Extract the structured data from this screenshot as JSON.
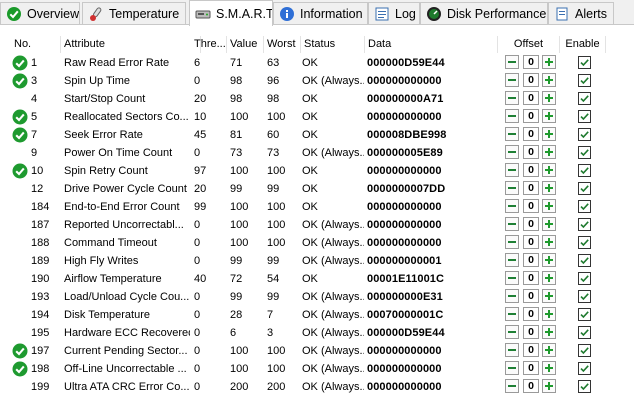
{
  "tabs": [
    {
      "label": "Overview",
      "icon": "overview-icon"
    },
    {
      "label": "Temperature",
      "icon": "thermometer-icon"
    },
    {
      "label": "S.M.A.R.T.",
      "icon": "drive-icon"
    },
    {
      "label": "Information",
      "icon": "info-icon"
    },
    {
      "label": "Log",
      "icon": "log-icon"
    },
    {
      "label": "Disk Performance",
      "icon": "performance-gauge-icon"
    },
    {
      "label": "Alerts",
      "icon": "alerts-icon"
    }
  ],
  "columns": [
    "No.",
    "Attribute",
    "Thre...",
    "Value",
    "Worst",
    "Status",
    "Data",
    "Offset",
    "Enable"
  ],
  "colors": {
    "ok_green": "#1e9a2f",
    "plus_green": "#1f9a2e",
    "minus_green": "#1f7f34"
  },
  "rows": [
    {
      "ok": true,
      "no": "1",
      "attr": "Raw Read Error Rate",
      "thr": "6",
      "val": "71",
      "worst": "63",
      "status": "OK",
      "data": "000000D59E44",
      "offset": "0",
      "enabled": true
    },
    {
      "ok": true,
      "no": "3",
      "attr": "Spin Up Time",
      "thr": "0",
      "val": "98",
      "worst": "96",
      "status": "OK (Always...",
      "data": "000000000000",
      "offset": "0",
      "enabled": true
    },
    {
      "ok": false,
      "no": "4",
      "attr": "Start/Stop Count",
      "thr": "20",
      "val": "98",
      "worst": "98",
      "status": "OK",
      "data": "000000000A71",
      "offset": "0",
      "enabled": true
    },
    {
      "ok": true,
      "no": "5",
      "attr": "Reallocated Sectors Co...",
      "thr": "10",
      "val": "100",
      "worst": "100",
      "status": "OK",
      "data": "000000000000",
      "offset": "0",
      "enabled": true
    },
    {
      "ok": true,
      "no": "7",
      "attr": "Seek Error Rate",
      "thr": "45",
      "val": "81",
      "worst": "60",
      "status": "OK",
      "data": "000008DBE998",
      "offset": "0",
      "enabled": true
    },
    {
      "ok": false,
      "no": "9",
      "attr": "Power On Time Count",
      "thr": "0",
      "val": "73",
      "worst": "73",
      "status": "OK (Always...",
      "data": "000000005E89",
      "offset": "0",
      "enabled": true
    },
    {
      "ok": true,
      "no": "10",
      "attr": "Spin Retry Count",
      "thr": "97",
      "val": "100",
      "worst": "100",
      "status": "OK",
      "data": "000000000000",
      "offset": "0",
      "enabled": true
    },
    {
      "ok": false,
      "no": "12",
      "attr": "Drive Power Cycle Count",
      "thr": "20",
      "val": "99",
      "worst": "99",
      "status": "OK",
      "data": "0000000007DD",
      "offset": "0",
      "enabled": true
    },
    {
      "ok": false,
      "no": "184",
      "attr": "End-to-End Error Count",
      "thr": "99",
      "val": "100",
      "worst": "100",
      "status": "OK",
      "data": "000000000000",
      "offset": "0",
      "enabled": true
    },
    {
      "ok": false,
      "no": "187",
      "attr": "Reported Uncorrectabl...",
      "thr": "0",
      "val": "100",
      "worst": "100",
      "status": "OK (Always...",
      "data": "000000000000",
      "offset": "0",
      "enabled": true
    },
    {
      "ok": false,
      "no": "188",
      "attr": "Command Timeout",
      "thr": "0",
      "val": "100",
      "worst": "100",
      "status": "OK (Always...",
      "data": "000000000000",
      "offset": "0",
      "enabled": true
    },
    {
      "ok": false,
      "no": "189",
      "attr": "High Fly Writes",
      "thr": "0",
      "val": "99",
      "worst": "99",
      "status": "OK (Always...",
      "data": "000000000001",
      "offset": "0",
      "enabled": true
    },
    {
      "ok": false,
      "no": "190",
      "attr": "Airflow Temperature",
      "thr": "40",
      "val": "72",
      "worst": "54",
      "status": "OK",
      "data": "00001E11001C",
      "offset": "0",
      "enabled": true
    },
    {
      "ok": false,
      "no": "193",
      "attr": "Load/Unload Cycle Cou...",
      "thr": "0",
      "val": "99",
      "worst": "99",
      "status": "OK (Always...",
      "data": "000000000E31",
      "offset": "0",
      "enabled": true
    },
    {
      "ok": false,
      "no": "194",
      "attr": "Disk Temperature",
      "thr": "0",
      "val": "28",
      "worst": "7",
      "status": "OK (Always...",
      "data": "00070000001C",
      "offset": "0",
      "enabled": true
    },
    {
      "ok": false,
      "no": "195",
      "attr": "Hardware ECC Recovered",
      "thr": "0",
      "val": "6",
      "worst": "3",
      "status": "OK (Always...",
      "data": "000000D59E44",
      "offset": "0",
      "enabled": true
    },
    {
      "ok": true,
      "no": "197",
      "attr": "Current Pending Sector...",
      "thr": "0",
      "val": "100",
      "worst": "100",
      "status": "OK (Always...",
      "data": "000000000000",
      "offset": "0",
      "enabled": true
    },
    {
      "ok": true,
      "no": "198",
      "attr": "Off-Line Uncorrectable ...",
      "thr": "0",
      "val": "100",
      "worst": "100",
      "status": "OK (Always...",
      "data": "000000000000",
      "offset": "0",
      "enabled": true
    },
    {
      "ok": false,
      "no": "199",
      "attr": "Ultra ATA CRC Error Co...",
      "thr": "0",
      "val": "200",
      "worst": "200",
      "status": "OK (Always...",
      "data": "000000000000",
      "offset": "0",
      "enabled": true
    }
  ]
}
